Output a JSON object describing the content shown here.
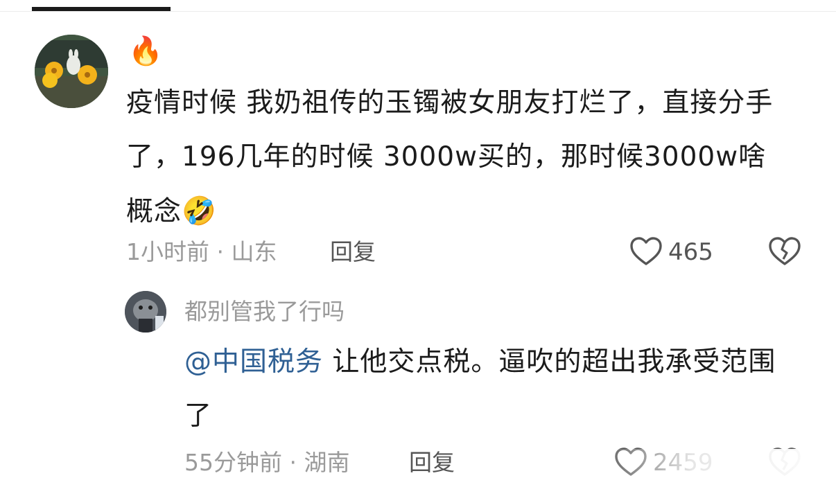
{
  "comments": [
    {
      "badge_icon": "fire-icon",
      "text": "疫情时候 我奶祖传的玉镯被女朋友打烂了，直接分手了，196几年的时候  3000w买的，那时候3000w啥概念",
      "emoji": "🤣",
      "time_location": "1小时前 · 山东",
      "reply_label": "回复",
      "like_count": "465"
    },
    {
      "username": "都别管我了行吗",
      "mention": "@中国税务",
      "text": " 让他交点税。逼吹的超出我承受范围了",
      "time_location": "55分钟前 · 湖南",
      "reply_label": "回复",
      "like_count": "2459"
    }
  ],
  "colors": {
    "mention": "#2f6094",
    "meta": "#9a9a9a"
  }
}
